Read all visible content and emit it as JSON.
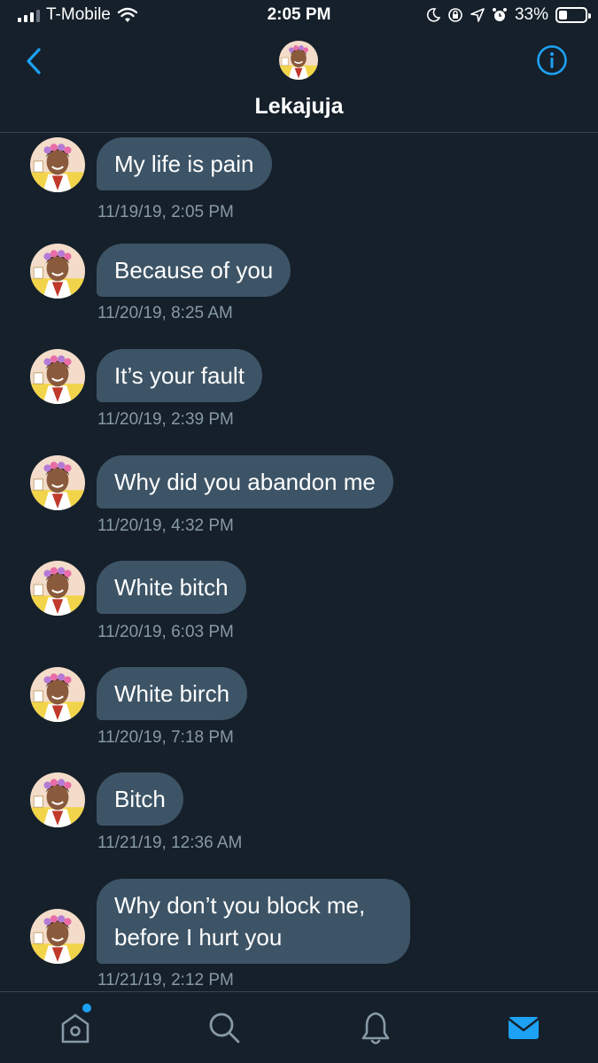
{
  "status_bar": {
    "carrier": "T-Mobile",
    "time": "2:05 PM",
    "battery_percent": "33%",
    "battery_level": 0.33,
    "icons": [
      "signal-icon",
      "wifi-icon",
      "moon-icon",
      "orientation-lock-icon",
      "location-icon",
      "alarm-icon",
      "battery-icon"
    ]
  },
  "header": {
    "contact_name": "Lekajuja",
    "back_icon": "chevron-left-icon",
    "info_icon": "info-icon"
  },
  "messages": [
    {
      "text": "My life is pain",
      "timestamp": "11/19/19, 2:05 PM"
    },
    {
      "text": "Because of you",
      "timestamp": "11/20/19, 8:25 AM"
    },
    {
      "text": "It’s your fault",
      "timestamp": "11/20/19, 2:39 PM"
    },
    {
      "text": "Why did you abandon me",
      "timestamp": "11/20/19, 4:32 PM"
    },
    {
      "text": "White bitch",
      "timestamp": "11/20/19, 6:03 PM"
    },
    {
      "text": "White birch",
      "timestamp": "11/20/19, 7:18 PM"
    },
    {
      "text": "Bitch",
      "timestamp": "11/21/19, 12:36 AM"
    },
    {
      "text": "Why don’t you block me, before I hurt you",
      "timestamp": "11/21/19, 2:12 PM"
    }
  ],
  "tab_bar": {
    "tabs": [
      {
        "name": "home",
        "icon": "home-icon",
        "badge": true
      },
      {
        "name": "search",
        "icon": "search-icon"
      },
      {
        "name": "notifications",
        "icon": "bell-icon"
      },
      {
        "name": "messages",
        "icon": "envelope-icon",
        "active": true
      }
    ]
  },
  "colors": {
    "background": "#15202b",
    "bubble": "#3d5466",
    "accent": "#1da1f2",
    "timestamp": "#8899a6",
    "divider": "#38444d"
  }
}
